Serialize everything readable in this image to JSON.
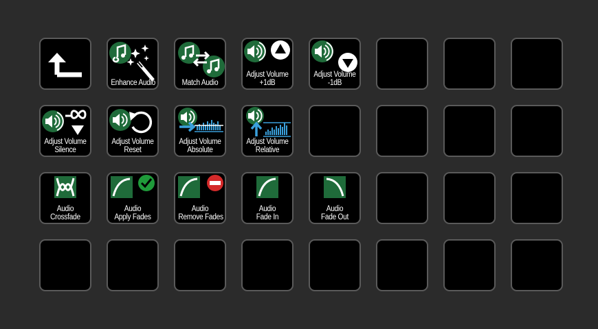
{
  "deck": {
    "keys": [
      {
        "icon": "back-arrow-icon",
        "line1": "",
        "line2": ""
      },
      {
        "icon": "enhance-audio-icon",
        "line1": "Enhance Audio",
        "line2": ""
      },
      {
        "icon": "match-audio-icon",
        "line1": "Match Audio",
        "line2": ""
      },
      {
        "icon": "volume-up-icon",
        "line1": "Adjust Volume",
        "line2": "+1dB"
      },
      {
        "icon": "volume-down-icon",
        "line1": "Adjust Volume",
        "line2": "-1dB"
      },
      {
        "icon": "volume-silence-icon",
        "line1": "Adjust Volume",
        "line2": "Silence"
      },
      {
        "icon": "volume-reset-icon",
        "line1": "Adjust Volume",
        "line2": "Reset"
      },
      {
        "icon": "volume-absolute-icon",
        "line1": "Adjust Volume",
        "line2": "Absolute"
      },
      {
        "icon": "volume-relative-icon",
        "line1": "Adjust Volume",
        "line2": "Relative"
      },
      {
        "icon": "crossfade-icon",
        "line1": "Audio",
        "line2": "Crossfade"
      },
      {
        "icon": "apply-fades-icon",
        "line1": "Audio",
        "line2": "Apply Fades"
      },
      {
        "icon": "remove-fades-icon",
        "line1": "Audio",
        "line2": "Remove Fades"
      },
      {
        "icon": "fade-in-icon",
        "line1": "Audio",
        "line2": "Fade In"
      },
      {
        "icon": "fade-out-icon",
        "line1": "Audio",
        "line2": "Fade Out"
      }
    ]
  },
  "colors": {
    "background": "#2b2b2b",
    "key_fill": "#000000",
    "key_border": "#5a5a5a",
    "icon_green": "#1f6b3a",
    "accent_blue": "#3aa0dc",
    "check_green": "#1f9a3a",
    "remove_red": "#d42a2a"
  }
}
